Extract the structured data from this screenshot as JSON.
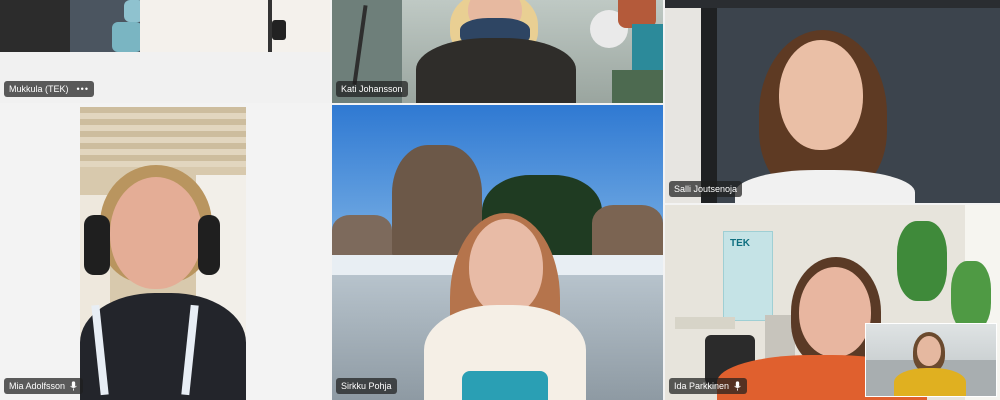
{
  "participants": [
    {
      "name": "Mukkula (TEK)",
      "more_label": "•••"
    },
    {
      "name": "Kati Johansson"
    },
    {
      "name": "Salli Joutsenoja"
    },
    {
      "name": "Mia Adolfsson"
    },
    {
      "name": "Sirkku Pohja"
    },
    {
      "name": "Ida Parkkinen"
    }
  ],
  "wall_poster": {
    "brand": "TEK"
  },
  "icons": {
    "mic": "microphone-icon",
    "more": "more-options-icon"
  }
}
